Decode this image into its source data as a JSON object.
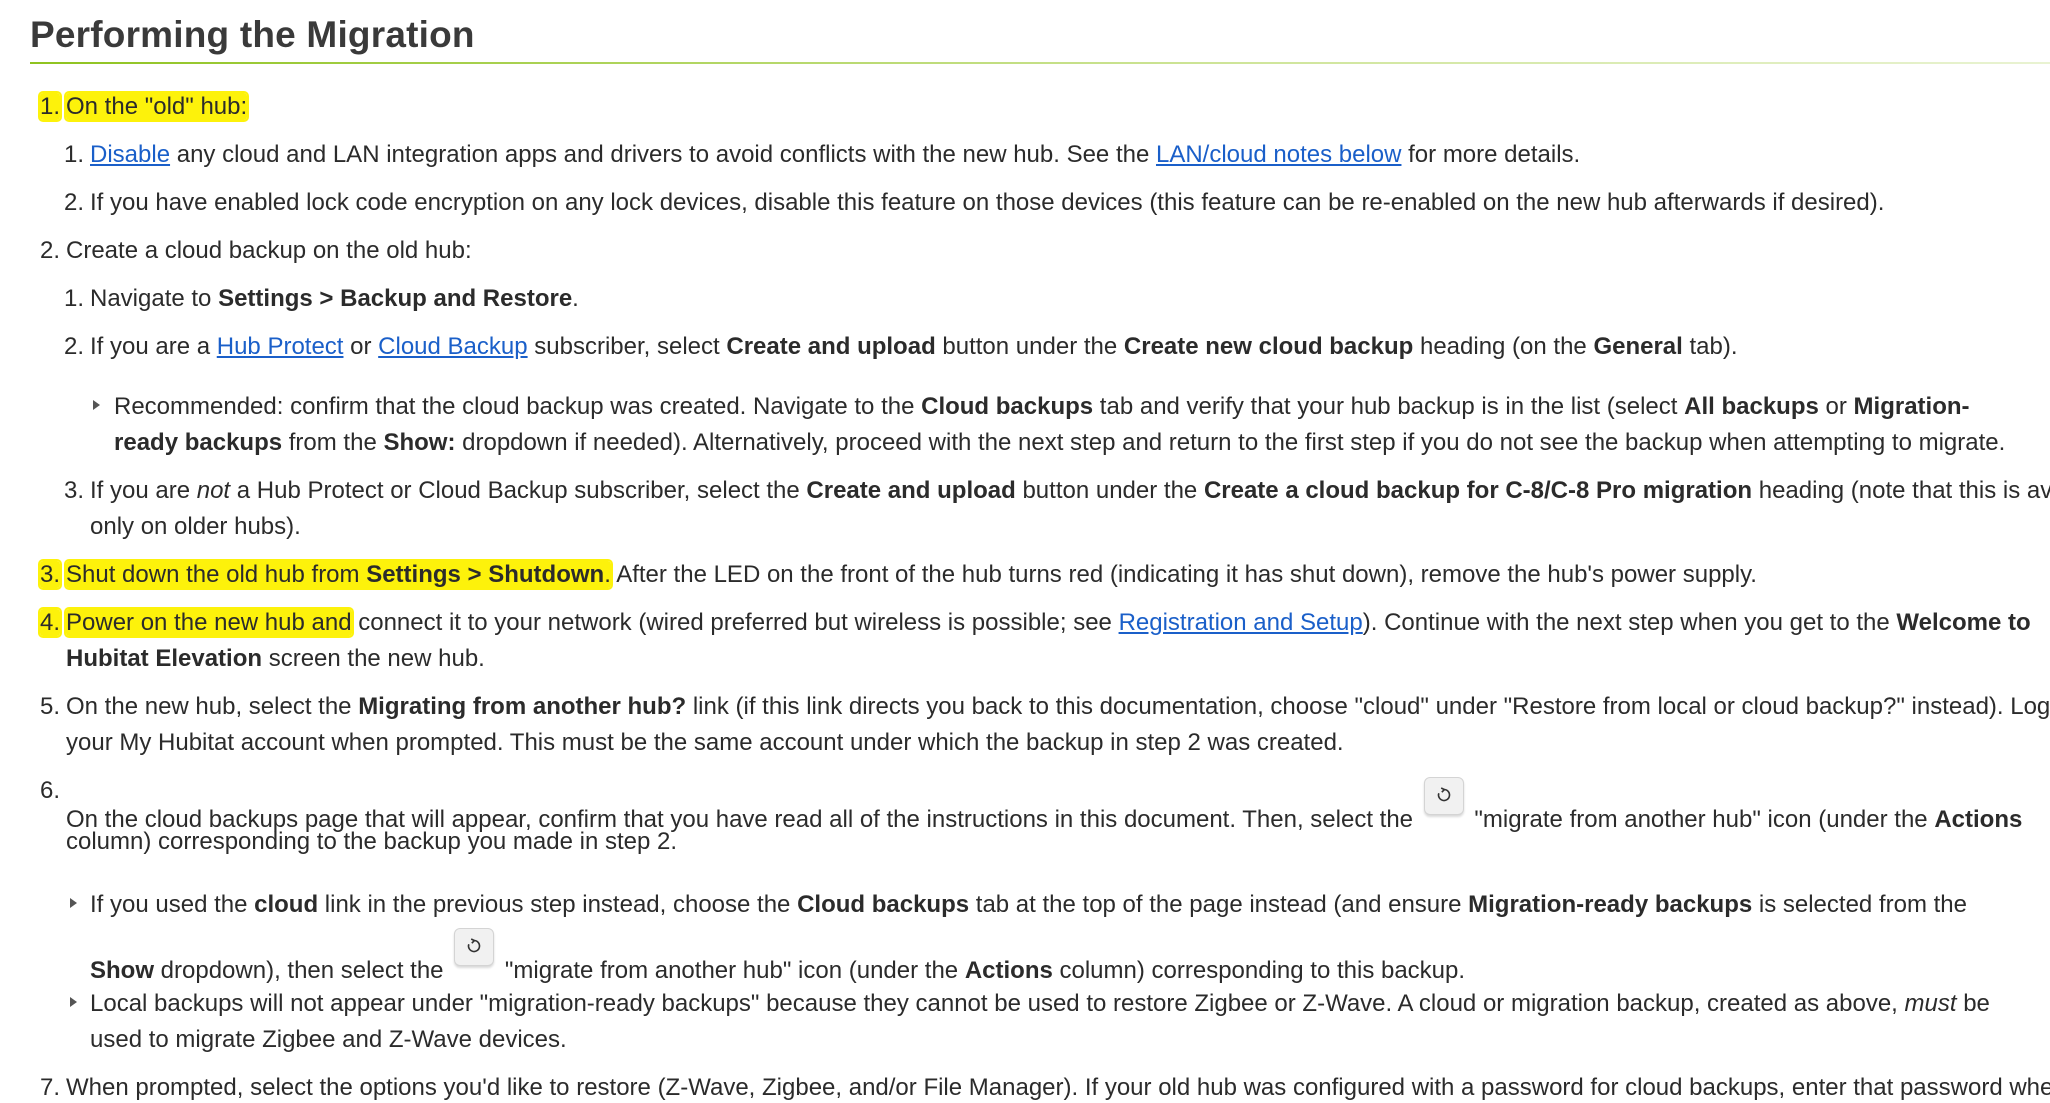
{
  "heading": "Performing the Migration",
  "s1": {
    "num": "1.",
    "text": "On the \"old\" hub:",
    "a_num": "1.",
    "a_link": "Disable",
    "a_t1": " any cloud and LAN integration apps and drivers to avoid conflicts with the new hub. See the ",
    "a_link2": "LAN/cloud notes below",
    "a_t2": " for more details.",
    "b_num": "2.",
    "b_text": "If you have enabled lock code encryption on any lock devices, disable this feature on those devices (this feature can be re-enabled on the new hub afterwards if desired)."
  },
  "s2": {
    "num": "2.",
    "text": "Create a cloud backup on the old hub:",
    "a_num": "1.",
    "a_t1": "Navigate to ",
    "a_b1": "Settings > Backup and Restore",
    "a_t2": ".",
    "b_num": "2.",
    "b_t1": "If you are a ",
    "b_link1": "Hub Protect",
    "b_t2": " or ",
    "b_link2": "Cloud Backup",
    "b_t3": " subscriber, select ",
    "b_b1": "Create and upload",
    "b_t4": " button under the ",
    "b_b2": "Create new cloud backup",
    "b_t5": " heading (on the ",
    "b_b3": "General",
    "b_t6": " tab).",
    "rec_t1": "Recommended: confirm that the cloud backup was created. Navigate to the ",
    "rec_b1": "Cloud backups",
    "rec_t2": " tab and verify that your hub backup is in the list (select ",
    "rec_b2": "All backups",
    "rec_t3": " or ",
    "rec_b3": "Migration-",
    "rec2_b1": "ready backups",
    "rec2_t1": " from the ",
    "rec2_b2": "Show:",
    "rec2_t2": " dropdown if needed). Alternatively, proceed with the next step and return to the first step if you do not see the backup when attempting to migrate.",
    "c_num": "3.",
    "c_t1": "If you are ",
    "c_i1": "not",
    "c_t2": " a Hub Protect or Cloud Backup subscriber, select the ",
    "c_b1": "Create and upload",
    "c_t3": " button under the ",
    "c_b2": "Create a cloud backup for C-8/C-8 Pro migration",
    "c_t4": " heading (note that this is availab",
    "c2_t1": "only on older hubs)."
  },
  "s3": {
    "num": "3.",
    "t1": "Shut down the old hub from ",
    "b1": "Settings > Shutdown",
    "t2": ".",
    "t3": " After the LED on the front of the hub turns red (indicating it has shut down), remove the hub's power supply."
  },
  "s4": {
    "num": "4.",
    "t1": "Power on the new hub and",
    "t2": " connect it to your network (wired preferred but wireless is possible; see ",
    "link": "Registration and Setup",
    "t3": "). Continue with the next step when you get to the ",
    "b1": "Welcome to",
    "b2": "Hubitat Elevation",
    "t4": " screen the new hub."
  },
  "s5": {
    "num": "5.",
    "t1": "On the new hub, select the ",
    "b1": "Migrating from another hub?",
    "t2": " link (if this link directs you back to this documentation, choose \"cloud\" under \"Restore from local or cloud backup?\" instead). Log in",
    "l2": "your My Hubitat account when prompted. This must be the same account under which the backup in step 2 was created."
  },
  "s6": {
    "num": "6.",
    "t1": "On the cloud backups page that will appear, confirm that you have read all of the instructions in this document. Then, select the ",
    "t2": " \"migrate from another hub\" icon (under the ",
    "b1": "Actions",
    "l2": "column) corresponding to the backup you made in step 2.",
    "bul1_t1": "If you used the ",
    "bul1_b1": "cloud",
    "bul1_t2": " link in the previous step instead, choose the ",
    "bul1_b2": "Cloud backups",
    "bul1_t3": " tab at the top of the page instead (and ensure ",
    "bul1_b3": "Migration-ready backups",
    "bul1_t4": " is selected from the",
    "bul1b_b1": "Show",
    "bul1b_t1": " dropdown), then select the ",
    "bul1b_t2": " \"migrate from another hub\" icon (under the ",
    "bul1b_b2": "Actions",
    "bul1b_t3": " column) corresponding to this backup.",
    "bul2_t1": "Local backups will not appear under \"migration-ready backups\" because they cannot be used to restore Zigbee or Z-Wave. A cloud or migration backup, created as above, ",
    "bul2_i1": "must",
    "bul2_t2": " be",
    "bul2b_t1": "used to migrate Zigbee and Z-Wave devices."
  },
  "s7": {
    "num": "7.",
    "t1": "When prompted, select the options you'd like to restore (Z-Wave, Zigbee, and/or File Manager). If your old hub was configured with a password for cloud backups, enter that password wher"
  },
  "icons": {
    "migrate": "restore-arrow-icon",
    "bullet": "triangle-bullet-icon"
  },
  "colors": {
    "highlight": "#fdf20b",
    "link": "#1a5fc9",
    "rule": "#8fc31f"
  }
}
